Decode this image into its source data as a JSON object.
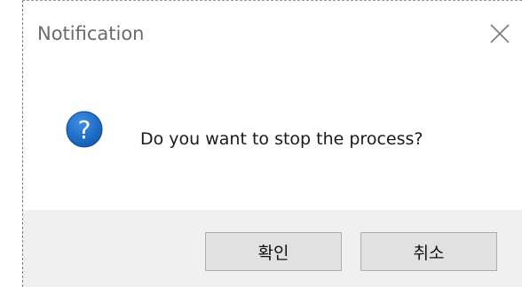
{
  "dialog": {
    "title": "Notification",
    "close_icon": "close-icon",
    "message": "Do you want to stop the process?",
    "message_icon": "question-icon",
    "icon_glyph": "?",
    "accent_color": "#1769c7"
  },
  "buttons": {
    "ok_label": "확인",
    "cancel_label": "취소"
  }
}
